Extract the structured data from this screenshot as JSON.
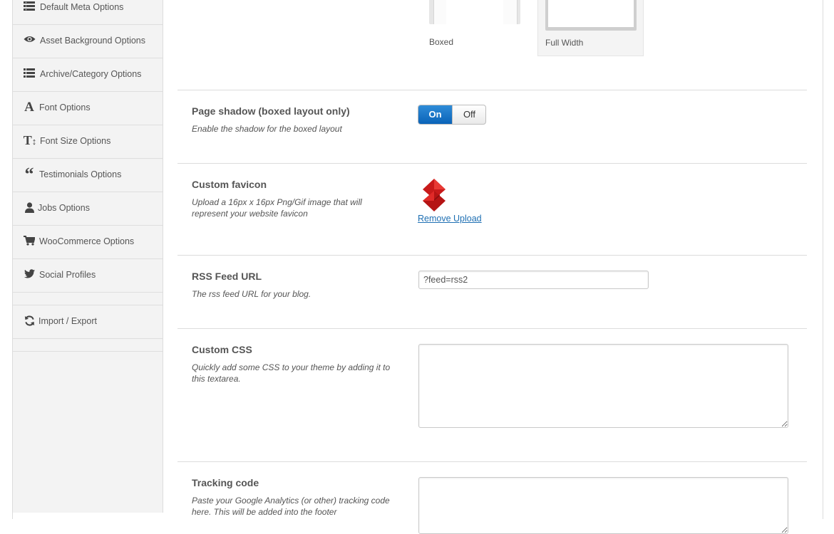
{
  "sidebar": {
    "items": [
      {
        "label": "Default Meta Options",
        "icon": "list-icon"
      },
      {
        "label": "Asset Background Options",
        "icon": "eye-icon"
      },
      {
        "label": "Archive/Category Options",
        "icon": "list-icon"
      },
      {
        "label": "Font Options",
        "icon": "font-icon"
      },
      {
        "label": "Font Size Options",
        "icon": "text-height-icon"
      },
      {
        "label": "Testimonials Options",
        "icon": "quote-icon"
      },
      {
        "label": "Jobs Options",
        "icon": "user-icon"
      },
      {
        "label": "WooCommerce Options",
        "icon": "cart-icon"
      },
      {
        "label": "Social Profiles",
        "icon": "twitter-icon"
      },
      {
        "label": "Import / Export",
        "icon": "refresh-icon"
      }
    ]
  },
  "layout": {
    "options": [
      {
        "label": "Boxed",
        "selected": false
      },
      {
        "label": "Full Width",
        "selected": true
      }
    ]
  },
  "page_shadow": {
    "title": "Page shadow (boxed layout only)",
    "description": "Enable the shadow for the boxed layout",
    "on_label": "On",
    "off_label": "Off",
    "value": "On",
    "accent_color": "#0a63b8"
  },
  "favicon": {
    "title": "Custom favicon",
    "description": "Upload a 16px x 16px Png/Gif image that will represent your website favicon",
    "remove_label": "Remove Upload",
    "link_color": "#1e6fb3",
    "preview_color": "#d9201f"
  },
  "rss": {
    "title": "RSS Feed URL",
    "description": "The rss feed URL for your blog.",
    "value": "?feed=rss2"
  },
  "custom_css": {
    "title": "Custom CSS",
    "description": "Quickly add some CSS to your theme by adding it to this textarea.",
    "value": ""
  },
  "tracking": {
    "title": "Tracking code",
    "description": "Paste your Google Analytics (or other) tracking code here. This will be added into the footer",
    "value": ""
  }
}
